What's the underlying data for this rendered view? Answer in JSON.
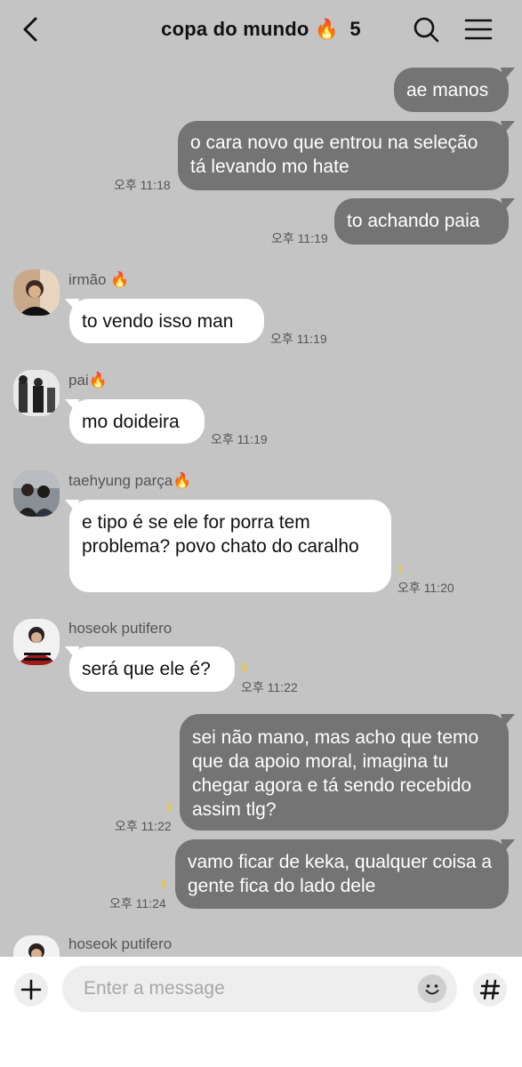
{
  "header": {
    "title": "copa do mundo 🔥",
    "member_count": "5"
  },
  "messages": [
    {
      "text": "ae manos"
    },
    {
      "text": "o cara novo que entrou na seleção tá levando mo hate",
      "time": "오후 11:18"
    },
    {
      "text": "to achando paia",
      "time": "오후 11:19"
    },
    {
      "sender": "irmão 🔥",
      "text": "to vendo isso man",
      "time": "오후 11:19"
    },
    {
      "sender": "pai🔥",
      "text": "mo doideira",
      "time": "오후 11:19"
    },
    {
      "sender": "taehyung parça🔥",
      "text": "e tipo é se ele for porra tem problema? povo chato do caralho",
      "unread": "1",
      "time": "오후 11:20"
    },
    {
      "sender": "hoseok putifero",
      "text": "será que ele é?",
      "unread": "3",
      "time": "오후 11:22"
    },
    {
      "text": "sei não mano, mas acho que temo que da apoio moral, imagina tu chegar agora e tá sendo recebido assim tlg?",
      "unread": "3",
      "time": "오후 11:22"
    },
    {
      "text": "vamo ficar de keka, qualquer coisa a gente fica do lado dele",
      "unread": "3",
      "time": "오후 11:24"
    },
    {
      "sender": "hoseok putifero"
    }
  ],
  "input": {
    "placeholder": "Enter a message"
  },
  "icons": {
    "back": "chevron-left-icon",
    "search": "search-icon",
    "menu": "hamburger-menu-icon",
    "plus": "plus-icon",
    "emoji": "emoji-icon",
    "hashtag": "hashtag-icon"
  },
  "colors": {
    "background": "#c4c4c4",
    "outgoing_bubble": "#747474",
    "incoming_bubble": "#ffffff",
    "unread_count": "#e6c64a"
  }
}
